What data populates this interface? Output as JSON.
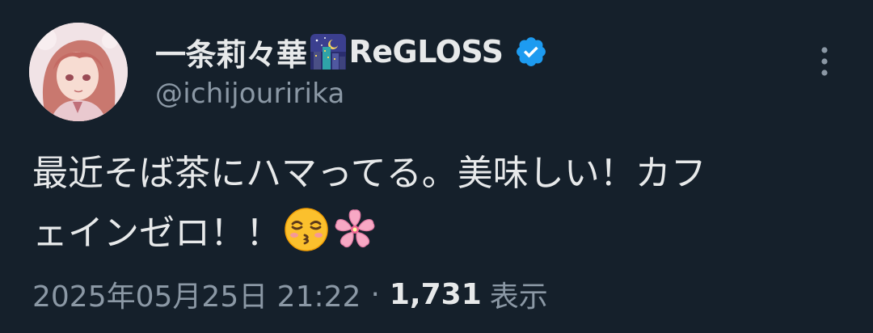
{
  "tweet": {
    "author": {
      "display_name": "一条莉々華",
      "display_name_suffix": "ReGLOSS",
      "handle": "@ichijouririka",
      "avatar_icon": "avatar-image",
      "name_emoji_icon": "night-city-emoji-icon",
      "verified_icon": "verified-badge-icon",
      "verified_color": "#1d9bf0"
    },
    "text_line1": "最近そば茶にハマってる。美味しい！カフ",
    "text_line2": "ェインゼロ！！",
    "text_emojis": [
      "kissing-face-emoji-icon",
      "cherry-blossom-emoji-icon"
    ],
    "timestamp": "2025年05月25日 21:22",
    "separator": "·",
    "views_count": "1,731",
    "views_label": "表示",
    "more_icon": "more-vertical-icon"
  },
  "colors": {
    "background": "#15202b",
    "text_primary": "#e7e9ea",
    "text_secondary": "#8b98a5",
    "accent": "#1d9bf0"
  }
}
